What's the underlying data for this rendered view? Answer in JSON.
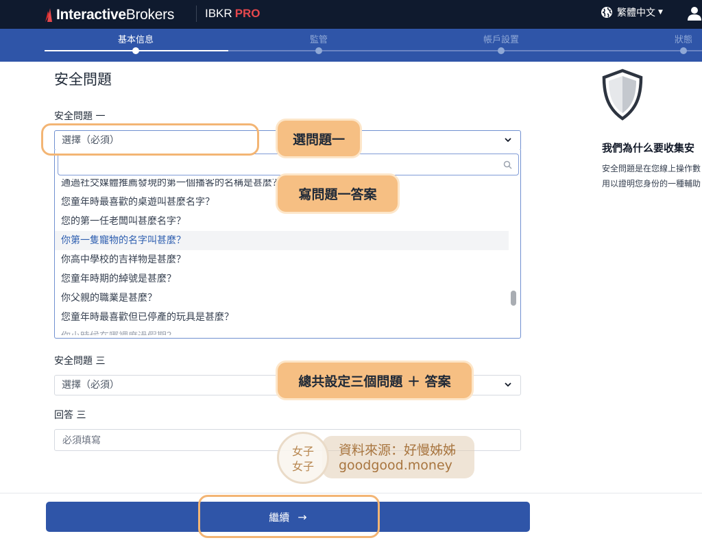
{
  "header": {
    "brand_prefix": "Interactive",
    "brand_suffix": "Brokers",
    "product": "IBKR",
    "product_tier": "PRO",
    "language": "繁體中文"
  },
  "stepper": {
    "steps": [
      {
        "label": "基本信息",
        "state": "active"
      },
      {
        "label": "監管",
        "state": "upcoming"
      },
      {
        "label": "帳戶設置",
        "state": "upcoming"
      },
      {
        "label": "狀態",
        "state": "upcoming"
      }
    ]
  },
  "form": {
    "title": "安全問題",
    "q1": {
      "label": "安全問題 一",
      "selected": "選擇（必須）",
      "search_placeholder": "",
      "options": [
        "通過社交媒體推薦發現的第一個播客的名稱是甚麼？",
        "您童年時最喜歡的桌遊叫甚麼名字？",
        "您的第一任老闆叫甚麼名字？",
        "你第一隻寵物的名字叫甚麼？",
        "你高中學校的吉祥物是甚麼？",
        "您童年時期的綽號是甚麼？",
        "你父親的職業是甚麼？",
        "您童年時最喜歡但已停產的玩具是甚麼？",
        "你小時候在哪裡度過假期？"
      ],
      "highlighted_index": 3
    },
    "q3": {
      "label": "安全問題 三",
      "selected": "選擇（必須）"
    },
    "a3": {
      "label": "回答 三",
      "placeholder": "必須填寫"
    },
    "continue_label": "繼續"
  },
  "info_panel": {
    "title": "我們為什么要收集安",
    "line1": "安全問題是在您線上操作數",
    "line2": "用以證明您身份的一種輔助"
  },
  "annotations": {
    "callout_q1": "選問題一",
    "callout_answer": "寫問題一答案",
    "callout_total": "總共設定三個問題 ＋ 答案"
  },
  "watermark": {
    "logo_line1": "女子",
    "logo_line2": "女子",
    "source": "資料來源：好慢姊姊",
    "site": "goodgood.money"
  },
  "icons": [
    "ib-logo-icon",
    "globe-icon",
    "caret-down-icon",
    "user-icon",
    "chevron-down-icon",
    "search-icon",
    "shield-icon",
    "arrow-right-icon"
  ],
  "colors": {
    "topbar": "#0f1a2e",
    "stepper": "#2f55a8",
    "accent_red": "#e5484d",
    "button": "#2f55a8",
    "highlight_text": "#2f5fb0",
    "annotation_orange": "#f6bf83"
  }
}
